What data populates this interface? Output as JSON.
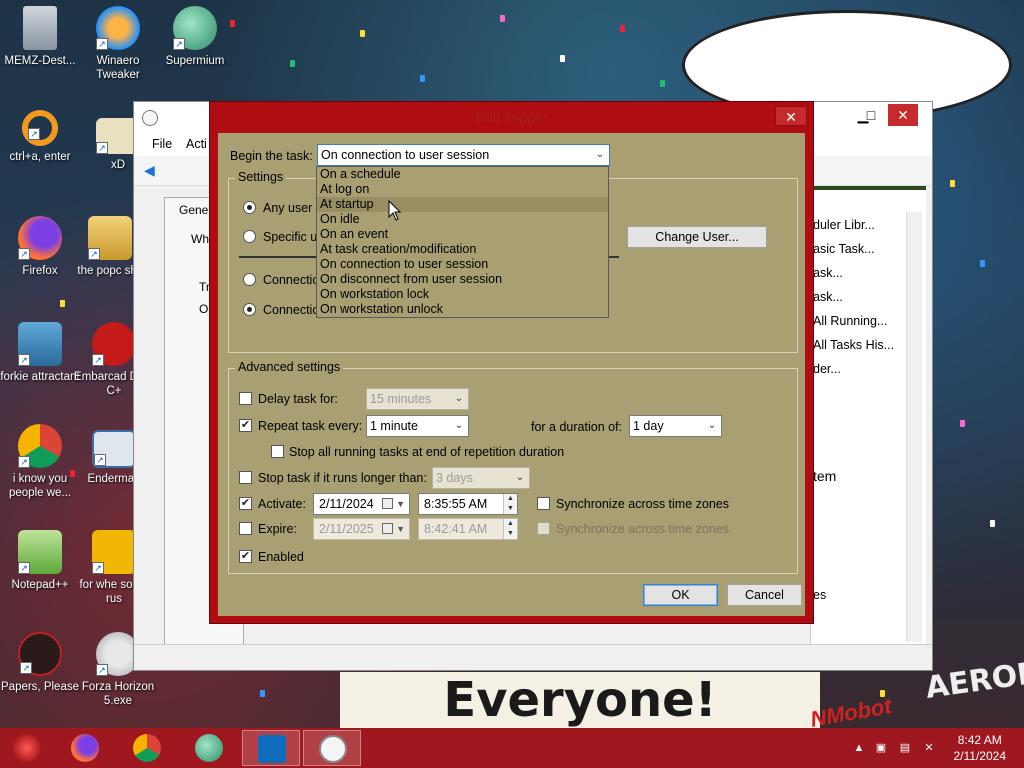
{
  "desktop": {
    "icons": [
      {
        "label": "MEMZ-Dest...",
        "icon": "recycle-bin-icon"
      },
      {
        "label": "Winaero Tweaker",
        "icon": "winaero-icon"
      },
      {
        "label": "Supermium",
        "icon": "supermium-icon"
      },
      {
        "label": "ctrl+a, enter",
        "icon": "ring-icon"
      },
      {
        "label": "xD",
        "icon": "hx-icon"
      },
      {
        "label": "Firefox",
        "icon": "firefox-icon"
      },
      {
        "label": "the popc shit",
        "icon": "folder-icon"
      },
      {
        "label": "forkie attractant",
        "icon": "computer-gear-icon"
      },
      {
        "label": "Embarcad Dev-C+",
        "icon": "devcpp-icon"
      },
      {
        "label": "i know you people we...",
        "icon": "chrome-icon"
      },
      {
        "label": "Enderman",
        "icon": "window-icon"
      },
      {
        "label": "Notepad++",
        "icon": "notepadpp-icon"
      },
      {
        "label": "for whe some rus",
        "icon": "die-icon"
      },
      {
        "label": "Papers, Please",
        "icon": "papers-please-icon"
      },
      {
        "label": "Forza Horizon 5.exe",
        "icon": "flash-icon"
      }
    ],
    "banner_text": "Everyone!",
    "banner_right_text": "AEROFOS",
    "watermark_text": "NMobot"
  },
  "background_window": {
    "menu": [
      "File",
      "Acti"
    ],
    "tabs": [
      "Gene",
      "Wh"
    ],
    "list_items": [
      "Tr",
      "On"
    ],
    "actions": [
      "duler Libr...",
      "asic Task...",
      "ask...",
      "ask...",
      "All Running...",
      "All Tasks His...",
      "der...",
      "tem",
      "es"
    ]
  },
  "dialog": {
    "title": "Edit Trigger",
    "begin_label": "Begin the task:",
    "begin_value": "On connection to user session",
    "settings": {
      "title": "Settings",
      "any_user": "Any user",
      "specific_user": "Specific us",
      "connection_1": "Connectio",
      "connection_2": "Connectio",
      "change_user_button": "Change User..."
    },
    "dropdown_options": [
      "On a schedule",
      "At log on",
      "At startup",
      "On idle",
      "On an event",
      "At task creation/modification",
      "On connection to user session",
      "On disconnect from user session",
      "On workstation lock",
      "On workstation unlock"
    ],
    "hovered_option": "At startup",
    "advanced": {
      "title": "Advanced settings",
      "delay_label": "Delay task for:",
      "delay_value": "15 minutes",
      "delay_checked": false,
      "repeat_label": "Repeat task every:",
      "repeat_value": "1 minute",
      "repeat_checked": true,
      "duration_label": "for a duration of:",
      "duration_value": "1 day",
      "stop_all_label": "Stop all running tasks at end of repetition duration",
      "stop_all_checked": false,
      "stop_longer_label": "Stop task if it runs longer than:",
      "stop_longer_value": "3 days",
      "stop_longer_checked": false,
      "activate_label": "Activate:",
      "activate_checked": true,
      "activate_date": "2/11/2024",
      "activate_time": "8:35:55 AM",
      "sync_1_label": "Synchronize across time zones",
      "expire_label": "Expire:",
      "expire_checked": false,
      "expire_date": "2/11/2025",
      "expire_time": "8:42:41 AM",
      "sync_2_label": "Synchronize across time zones",
      "enabled_label": "Enabled",
      "enabled_checked": true
    },
    "ok_button": "OK",
    "cancel_button": "Cancel"
  },
  "taskbar": {
    "apps": [
      "memz-icon",
      "firefox-icon",
      "chrome-icon",
      "supermium-icon",
      "outlook-icon",
      "task-scheduler-icon"
    ],
    "clock_time": "8:42 AM",
    "clock_date": "2/11/2024"
  }
}
